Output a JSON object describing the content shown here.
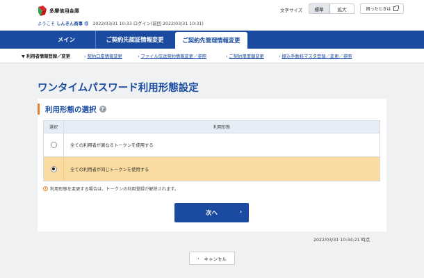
{
  "header": {
    "bank_name": "多摩信用金庫",
    "font_size_label": "文字サイズ",
    "font_size_standard": "標準",
    "font_size_large": "拡大",
    "help_label": "困ったときは",
    "welcome_prefix": "ようこそ",
    "user_name": "しんきん商事",
    "user_suffix": "様",
    "login_info": "2022/03/31 10:33 ログイン(前回 2022/03/31 10:31)"
  },
  "nav": {
    "tabs": [
      {
        "label": "メイン"
      },
      {
        "label": "ご契約先認証情報変更"
      },
      {
        "label": "ご契約先管理情報変更"
      }
    ]
  },
  "subnav": {
    "current": "▼ 利用者情報登録／変更",
    "links": [
      {
        "label": "契約口座情報変更"
      },
      {
        "label": "ファイル伝送契約情報変更／参照"
      },
      {
        "label": "ご契約限度額変更"
      },
      {
        "label": "振込手数料マスタ登録／変更／参照"
      }
    ]
  },
  "page": {
    "title": "ワンタイムパスワード利用形態設定",
    "section_title": "利用形態の選択",
    "help_icon_glyph": "?",
    "table": {
      "headers": {
        "select": "選択",
        "type": "利用形態"
      },
      "rows": [
        {
          "label": "全ての利用者が異なるトークンを使用する",
          "selected": false
        },
        {
          "label": "全ての利用者が同じトークンを使用する",
          "selected": true
        }
      ]
    },
    "notice": "利用形態を変更する場合は、トークンの利用登録が解除されます。",
    "next_label": "次へ",
    "timestamp": "2022/03/31 10:34:21 時点",
    "cancel_label": "キャンセル"
  },
  "colors": {
    "brand": "#1a4ba0",
    "accent": "#e8812a",
    "selected_row": "#fbdca0",
    "logo_red": "#d9262f",
    "logo_green": "#2aa84a"
  },
  "icons": {
    "help": "external-window-icon",
    "section_help": "question-icon",
    "notice": "info-icon",
    "next": "chevron-right-icon",
    "cancel": "chevron-left-icon"
  }
}
